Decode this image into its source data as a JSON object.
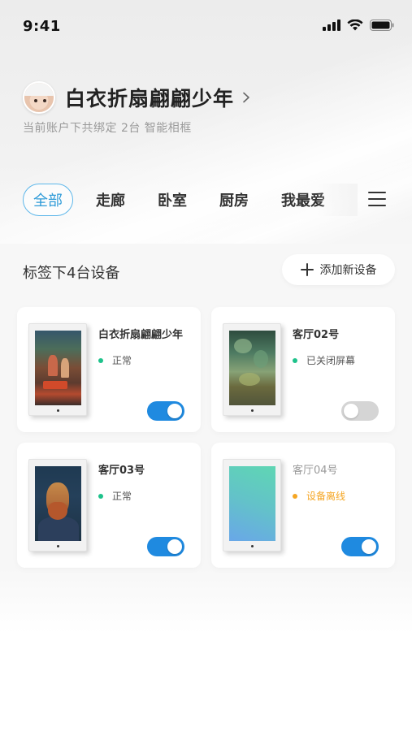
{
  "status_bar": {
    "time": "9:41"
  },
  "profile": {
    "name": "白衣折扇翩翩少年",
    "account_desc": "当前账户下共绑定 2台 智能相框"
  },
  "tabs": [
    {
      "label": "全部",
      "active": true
    },
    {
      "label": "走廊",
      "active": false
    },
    {
      "label": "卧室",
      "active": false
    },
    {
      "label": "厨房",
      "active": false
    },
    {
      "label": "我最爱",
      "active": false
    }
  ],
  "section": {
    "title": "标签下4台设备",
    "add_button_label": "添加新设备"
  },
  "devices": [
    {
      "name": "白衣折扇翩翩少年",
      "status": "正常",
      "status_color": "#1ec28b",
      "toggle_on": true
    },
    {
      "name": "客厅02号",
      "status": "已关闭屏幕",
      "status_color": "#1ec28b",
      "toggle_on": false
    },
    {
      "name": "客厅03号",
      "status": "正常",
      "status_color": "#1ec28b",
      "toggle_on": true
    },
    {
      "name": "客厅04号",
      "status": "设备离线",
      "status_color": "#f5a623",
      "toggle_on": true
    }
  ],
  "colors": {
    "accent": "#2f9bd8",
    "toggle_on": "#1f8ae0",
    "toggle_off": "#d5d5d5",
    "offline": "#f5a623",
    "online": "#1ec28b"
  }
}
